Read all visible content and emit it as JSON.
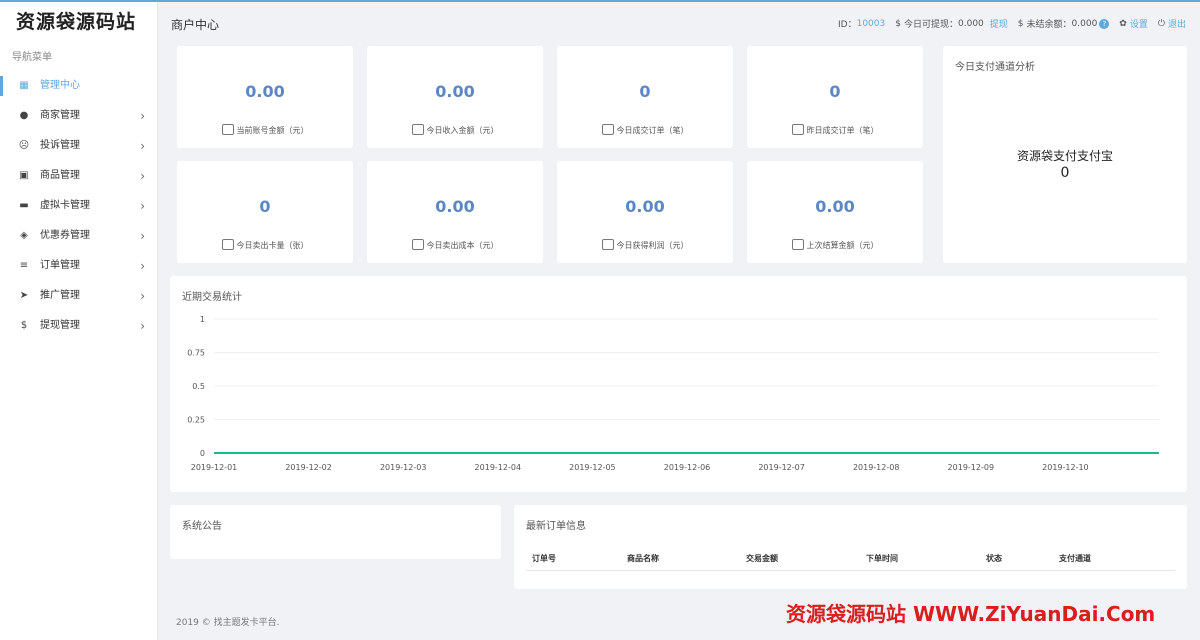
{
  "brand": "资源袋源码站",
  "sidebar": {
    "title": "导航菜单",
    "items": [
      {
        "label": "管理中心",
        "icon": "▦",
        "active": true
      },
      {
        "label": "商家管理",
        "icon": "●"
      },
      {
        "label": "投诉管理",
        "icon": "☹"
      },
      {
        "label": "商品管理",
        "icon": "▣"
      },
      {
        "label": "虚拟卡管理",
        "icon": "▬"
      },
      {
        "label": "优惠券管理",
        "icon": "◈"
      },
      {
        "label": "订单管理",
        "icon": "≡"
      },
      {
        "label": "推广管理",
        "icon": "➤"
      },
      {
        "label": "提现管理",
        "icon": "$"
      }
    ],
    "chevron": "›"
  },
  "header": {
    "title": "商户中心",
    "id_label": "ID：",
    "id_value": "10003",
    "withdrawable_label": "今日可提现：",
    "withdrawable_value": "0.000",
    "withdraw_link": "提现",
    "unsettled_label": "未结余额：",
    "unsettled_value": "0.000",
    "settings": "设置",
    "logout": "退出",
    "dollar_icon": "$",
    "gear_icon": "✿",
    "power_icon": "⏻"
  },
  "stats": [
    {
      "value": "0.00",
      "label": "当前账号金额（元）"
    },
    {
      "value": "0.00",
      "label": "今日收入金额（元）"
    },
    {
      "value": "0",
      "label": "今日成交订单（笔）"
    },
    {
      "value": "0",
      "label": "昨日成交订单（笔）"
    },
    {
      "value": "0",
      "label": "今日卖出卡量（张）"
    },
    {
      "value": "0.00",
      "label": "今日卖出成本（元）"
    },
    {
      "value": "0.00",
      "label": "今日获得利润（元）"
    },
    {
      "value": "0.00",
      "label": "上次结算金额（元）"
    }
  ],
  "analysis": {
    "title": "今日支付通道分析",
    "channel_name": "资源袋支付支付宝",
    "channel_value": "0"
  },
  "chart_title": "近期交易统计",
  "chart_data": {
    "type": "line",
    "title": "近期交易统计",
    "x": [
      "2019-12-01",
      "2019-12-02",
      "2019-12-03",
      "2019-12-04",
      "2019-12-05",
      "2019-12-06",
      "2019-12-07",
      "2019-12-08",
      "2019-12-09",
      "2019-12-10"
    ],
    "yticks": [
      "0",
      "0.25",
      "0.5",
      "0.75",
      "1"
    ],
    "ylim": [
      0,
      1
    ],
    "series": [
      {
        "values": [
          0,
          0,
          0,
          0,
          0,
          0,
          0,
          0,
          0,
          0,
          0
        ],
        "color": "#19b98d"
      }
    ],
    "grid": true
  },
  "announcement": {
    "title": "系统公告"
  },
  "orders": {
    "title": "最新订单信息",
    "columns": [
      "订单号",
      "商品名称",
      "交易金额",
      "下单时间",
      "状态",
      "支付通道"
    ]
  },
  "footer": "2019 © 找主题发卡平台.",
  "watermark": "资源袋源码站  WWW.ZiYuanDai.Com",
  "colors": {
    "accent": "#5da9dd",
    "value": "#5b87c4",
    "line": "#19b98d",
    "watermark": "#d81e1e"
  }
}
